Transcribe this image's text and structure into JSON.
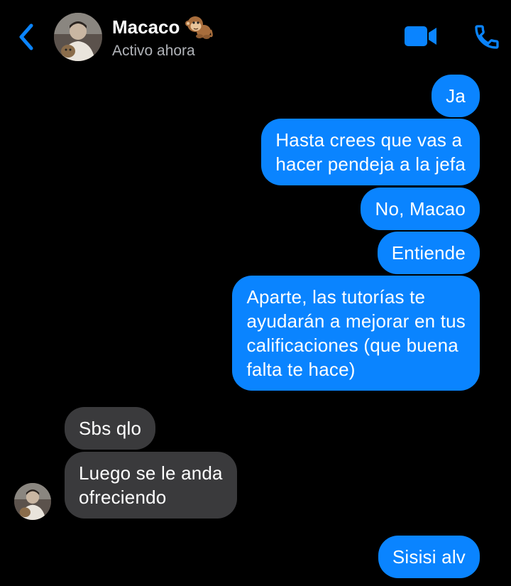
{
  "header": {
    "contact_name": "Macaco",
    "contact_emoji": "monkey",
    "status": "Activo ahora",
    "back_icon": "chevron-left-icon",
    "video_icon": "video-camera-icon",
    "phone_icon": "phone-icon"
  },
  "colors": {
    "background": "#000000",
    "outgoing_bubble": "#0a84ff",
    "incoming_bubble": "#3a3a3c",
    "accent": "#0a84ff",
    "status_text": "#b0b3b8"
  },
  "messages": [
    {
      "direction": "outgoing",
      "text": "Ja"
    },
    {
      "direction": "outgoing",
      "text": "Hasta crees que vas a\nhacer pendeja a la jefa"
    },
    {
      "direction": "outgoing",
      "text": "No, Macao"
    },
    {
      "direction": "outgoing",
      "text": "Entiende"
    },
    {
      "direction": "outgoing",
      "text": "Aparte, las tutorías te\nayudarán a mejorar en tus\ncalificaciones (que buena\nfalta te hace)"
    },
    {
      "direction": "incoming",
      "text": "Sbs qlo"
    },
    {
      "direction": "incoming",
      "text": "Luego se le anda\nofreciendo"
    },
    {
      "direction": "outgoing",
      "text": "Sisisi alv"
    }
  ]
}
